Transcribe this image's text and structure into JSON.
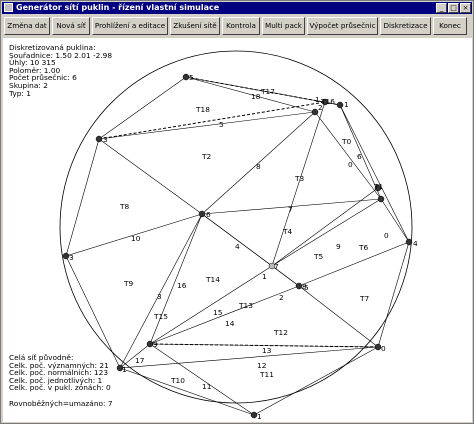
{
  "window": {
    "title": "Generátor sítí puklin - řízení vlastní simulace",
    "controls": [
      "_",
      "□",
      "×"
    ]
  },
  "toolbar": {
    "buttons": [
      "Změna dat",
      "Nová síť",
      "Prohlížení a editace",
      "Zkušení sítě",
      "Kontrola",
      "Multi pack",
      "Výpočet průsečnic",
      "Diskretizace",
      "Konec"
    ]
  },
  "info_top": {
    "lines": [
      "Diskretizovaná puklina:",
      "Souřadnice: 1.50 2.01 -2.98",
      "Úhly: 10 315",
      "Poloměr: 1.00",
      "Počet průsečnic: 6",
      "Skupina: 2",
      "Typ: 1"
    ]
  },
  "info_bottom": {
    "lines": [
      "Celá síť původně:",
      "Celk. poč. významných: 21",
      "Celk. poč. normálních: 123",
      "Celk. poč. jednotlivých: 1",
      "Celk. poč. v pukl. zónách: 0",
      "",
      "Rovnoběžných=umazáno: 7"
    ]
  },
  "diagram": {
    "node_labels": [
      "0",
      "1",
      "2",
      "3",
      "4",
      "5",
      "6",
      "7",
      "8",
      "9",
      "0",
      "1",
      "1",
      "3",
      "1",
      "5"
    ],
    "edge_labels": [
      "1",
      "2",
      "3",
      "4",
      "5",
      "6",
      "7",
      "8",
      "9",
      "10",
      "11",
      "12",
      "13",
      "14",
      "15",
      "16",
      "17",
      "18",
      "0"
    ],
    "triangle_labels": [
      "T0",
      "T1",
      "T2",
      "T3",
      "T4",
      "T5",
      "T6",
      "T7",
      "T8",
      "T9",
      "T10",
      "T11",
      "T12",
      "T13",
      "T14",
      "T15",
      "T16",
      "T17",
      "T18"
    ]
  }
}
